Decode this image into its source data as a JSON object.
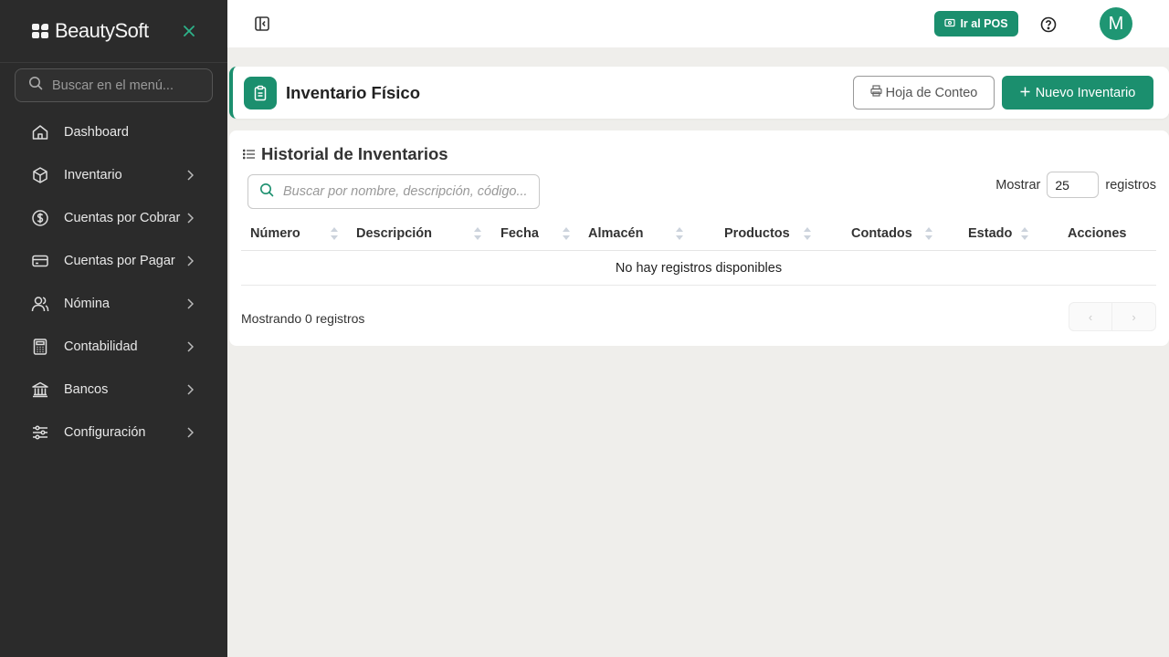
{
  "app": {
    "brand_name": "BeautySoft"
  },
  "sidebar": {
    "search_placeholder": "Buscar en el menú...",
    "items": [
      {
        "label": "Dashboard",
        "icon": "home-icon",
        "has_chevron": false
      },
      {
        "label": "Inventario",
        "icon": "box-icon",
        "has_chevron": true
      },
      {
        "label": "Cuentas por Cobrar",
        "icon": "dollar-circle-icon",
        "has_chevron": true
      },
      {
        "label": "Cuentas por Pagar",
        "icon": "credit-card-icon",
        "has_chevron": true
      },
      {
        "label": "Nómina",
        "icon": "users-icon",
        "has_chevron": true
      },
      {
        "label": "Contabilidad",
        "icon": "calculator-icon",
        "has_chevron": true
      },
      {
        "label": "Bancos",
        "icon": "bank-icon",
        "has_chevron": true
      },
      {
        "label": "Configuración",
        "icon": "sliders-icon",
        "has_chevron": true
      }
    ]
  },
  "topbar": {
    "pos_label": "Ir al POS",
    "avatar_initial": "M"
  },
  "page": {
    "title": "Inventario Físico",
    "btn_count_sheet": "Hoja de Conteo",
    "btn_new": "Nuevo Inventario"
  },
  "history": {
    "title": "Historial de Inventarios",
    "search_placeholder": "Buscar por nombre, descripción, código...",
    "show_label": "Mostrar",
    "show_value": "25",
    "records_label": "registros",
    "columns": [
      "Número",
      "Descripción",
      "Fecha",
      "Almacén",
      "Productos",
      "Contados",
      "Estado",
      "Acciones"
    ],
    "empty_text": "No hay registros disponibles",
    "footer_text": "Mostrando 0 registros",
    "prev_symbol": "‹",
    "next_symbol": "›"
  },
  "colors": {
    "accent": "#1b8f6e",
    "sidebar_bg": "#2b2b2b",
    "page_bg": "#efeeeb"
  }
}
